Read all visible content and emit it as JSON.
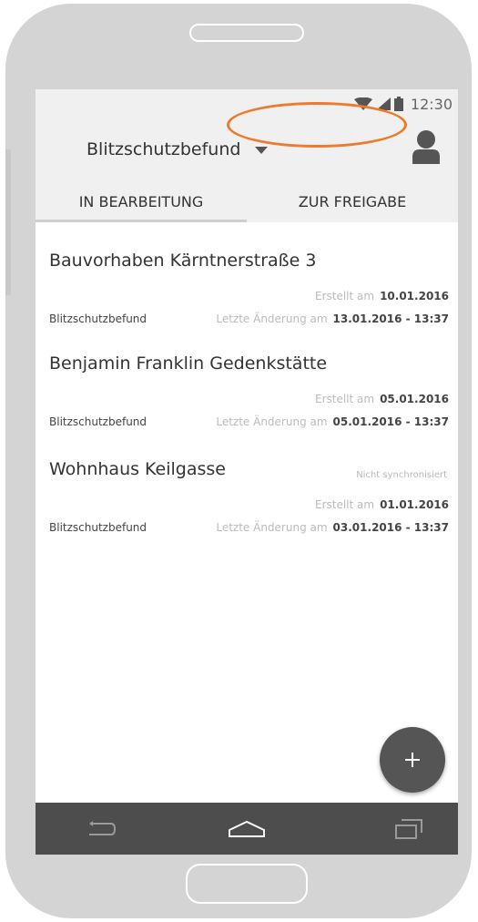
{
  "status_bar": {
    "time": "12:30",
    "icons": [
      "wifi-icon",
      "signal-icon",
      "battery-icon"
    ]
  },
  "app_bar": {
    "title": "Blitzschutzbefund",
    "icons": [
      "chevron-down-icon",
      "avatar-icon"
    ]
  },
  "tabs": [
    {
      "label": "IN BEARBEITUNG",
      "active": true
    },
    {
      "label": "ZUR FREIGABE",
      "active": false,
      "highlighted": true
    }
  ],
  "items": [
    {
      "title": "Bauvorhaben Kärntnerstraße 3",
      "sync_status": "",
      "created_label": "Erstellt am",
      "created_value": "10.01.2016",
      "type": "Blitzschutzbefund",
      "modified_label": "Letzte Änderung am",
      "modified_value": "13.01.2016 - 13:37"
    },
    {
      "title": "Benjamin Franklin Gedenkstätte",
      "sync_status": "",
      "created_label": "Erstellt am",
      "created_value": "05.01.2016",
      "type": "Blitzschutzbefund",
      "modified_label": "Letzte Änderung am",
      "modified_value": "05.01.2016 - 13:37"
    },
    {
      "title": "Wohnhaus Keilgasse",
      "sync_status": "Nicht synchronisiert",
      "created_label": "Erstellt am",
      "created_value": "01.01.2016",
      "type": "Blitzschutzbefund",
      "modified_label": "Letzte Änderung am",
      "modified_value": "03.01.2016 - 13:37"
    }
  ],
  "fab": {
    "label": "+",
    "icon": "plus-icon"
  },
  "nav_bar": {
    "icons": [
      "back-icon",
      "home-icon",
      "recents-icon"
    ]
  },
  "colors": {
    "highlight": "#ee7a2d",
    "app_bar_bg": "#f0f0f0",
    "nav_bar_bg": "#4d4d4d",
    "fab_bg": "#555555",
    "device_frame": "#d4d4d4"
  }
}
